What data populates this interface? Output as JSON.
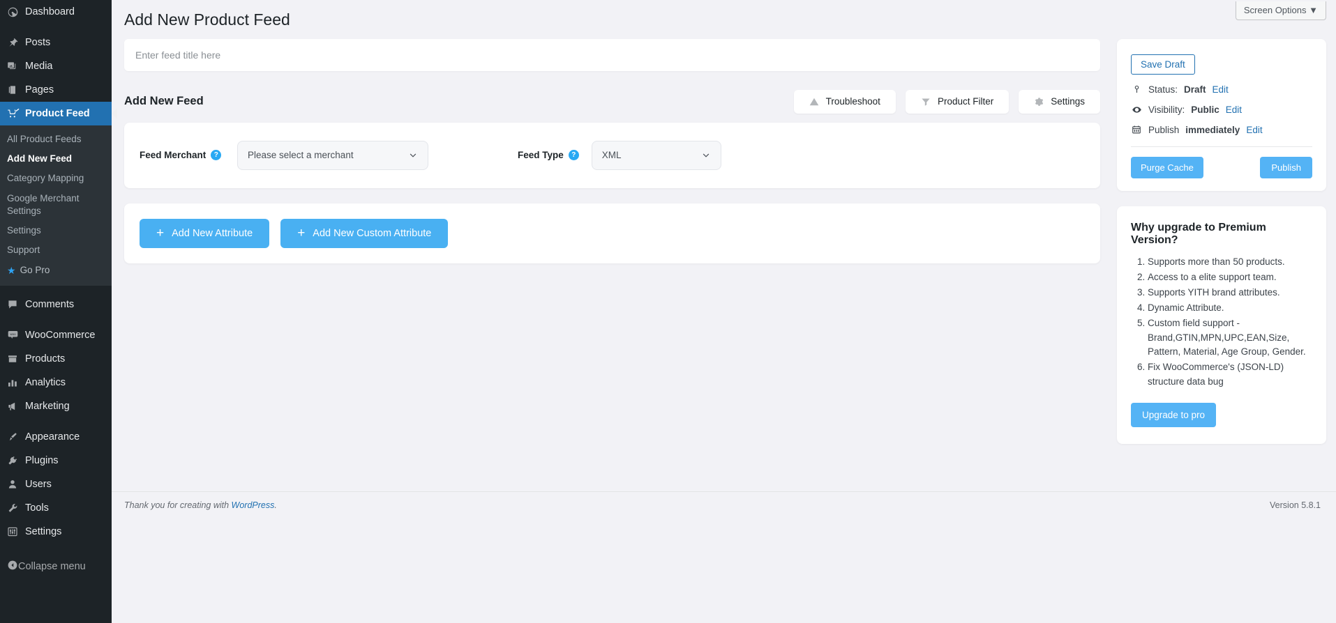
{
  "sidebar": {
    "items": [
      {
        "label": "Dashboard",
        "icon": "dashboard-icon",
        "active": false
      },
      {
        "label": "Posts",
        "icon": "pin-icon",
        "active": false
      },
      {
        "label": "Media",
        "icon": "media-icon",
        "active": false
      },
      {
        "label": "Pages",
        "icon": "pages-icon",
        "active": false
      },
      {
        "label": "Product Feed",
        "icon": "product-feed-icon",
        "active": true
      },
      {
        "label": "Comments",
        "icon": "comments-icon",
        "active": false
      },
      {
        "label": "WooCommerce",
        "icon": "woocommerce-icon",
        "active": false
      },
      {
        "label": "Products",
        "icon": "products-icon",
        "active": false
      },
      {
        "label": "Analytics",
        "icon": "analytics-icon",
        "active": false
      },
      {
        "label": "Marketing",
        "icon": "marketing-icon",
        "active": false
      },
      {
        "label": "Appearance",
        "icon": "appearance-icon",
        "active": false
      },
      {
        "label": "Plugins",
        "icon": "plugins-icon",
        "active": false
      },
      {
        "label": "Users",
        "icon": "users-icon",
        "active": false
      },
      {
        "label": "Tools",
        "icon": "tools-icon",
        "active": false
      },
      {
        "label": "Settings",
        "icon": "settings-icon",
        "active": false
      }
    ],
    "submenu": [
      {
        "label": "All Product Feeds",
        "current": false
      },
      {
        "label": "Add New Feed",
        "current": true
      },
      {
        "label": "Category Mapping",
        "current": false
      },
      {
        "label": "Google Merchant Settings",
        "current": false
      },
      {
        "label": "Settings",
        "current": false
      },
      {
        "label": "Support",
        "current": false
      },
      {
        "label": "Go Pro",
        "current": false,
        "star": true
      }
    ],
    "collapse_label": "Collapse menu"
  },
  "header": {
    "screen_options_label": "Screen Options",
    "screen_options_caret": "▼",
    "page_title": "Add New Product Feed"
  },
  "title_field": {
    "placeholder": "Enter feed title here",
    "value": ""
  },
  "section": {
    "title": "Add New Feed",
    "actions": [
      {
        "label": "Troubleshoot",
        "icon": "warning-triangle-icon"
      },
      {
        "label": "Product Filter",
        "icon": "filter-funnel-icon"
      },
      {
        "label": "Settings",
        "icon": "gear-icon"
      }
    ]
  },
  "feed_form": {
    "merchant_label": "Feed Merchant",
    "merchant_value": "Please select a merchant",
    "feed_type_label": "Feed Type",
    "feed_type_value": "XML",
    "help_glyph": "?"
  },
  "attributes": {
    "add_attribute_label": "Add New Attribute",
    "add_custom_attribute_label": "Add New Custom Attribute",
    "plus_glyph": "+"
  },
  "publish_box": {
    "save_draft_label": "Save Draft",
    "status_prefix": "Status:",
    "status_value": "Draft",
    "status_edit": "Edit",
    "visibility_prefix": "Visibility:",
    "visibility_value": "Public",
    "visibility_edit": "Edit",
    "publish_prefix": "Publish",
    "publish_value": "immediately",
    "publish_edit": "Edit",
    "purge_cache_label": "Purge Cache",
    "publish_label": "Publish"
  },
  "premium_box": {
    "heading": "Why upgrade to Premium Version?",
    "items": [
      "Supports more than 50 products.",
      "Access to a elite support team.",
      "Supports YITH brand attributes.",
      "Dynamic Attribute.",
      "Custom field support - Brand,GTIN,MPN,UPC,EAN,Size, Pattern, Material, Age Group, Gender.",
      "Fix WooCommerce's (JSON-LD) structure data bug"
    ],
    "upgrade_label": "Upgrade to pro"
  },
  "footer": {
    "thanks_prefix": "Thank you for creating with ",
    "wordpress_link": "WordPress",
    "thanks_suffix": ".",
    "version": "Version 5.8.1"
  },
  "colors": {
    "sidebar_bg": "#1d2327",
    "submenu_bg": "#2c3338",
    "active_blue": "#2271b1",
    "accent_blue": "#49b0f2",
    "link_blue": "#2271b1",
    "page_bg": "#f2f2f6"
  }
}
